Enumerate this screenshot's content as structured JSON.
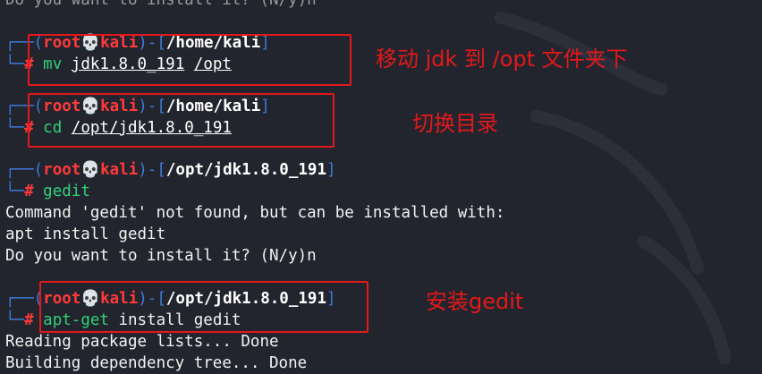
{
  "terminal": {
    "top_partial": "Do you want to install it? (N/y)n",
    "blocks": [
      {
        "user": "root",
        "skull": "💀",
        "host": "kali",
        "path": "/home/kali",
        "hash": "#",
        "command": "mv",
        "args": [
          "jdk1.8.0_191",
          "/opt"
        ]
      },
      {
        "user": "root",
        "skull": "💀",
        "host": "kali",
        "path": "/home/kali",
        "hash": "#",
        "command": "cd",
        "args": [
          "/opt/jdk1.8.0_191"
        ]
      },
      {
        "user": "root",
        "skull": "💀",
        "host": "kali",
        "path": "/opt/jdk1.8.0_191",
        "hash": "#",
        "command": "gedit",
        "output": [
          "Command 'gedit' not found, but can be installed with:",
          "apt install gedit",
          "Do you want to install it? (N/y)n"
        ]
      },
      {
        "user": "root",
        "skull": "💀",
        "host": "kali",
        "path": "/opt/jdk1.8.0_191",
        "hash": "#",
        "command": "apt-get",
        "rest": "install gedit",
        "output": [
          "Reading package lists... Done",
          "Building dependency tree... Done"
        ]
      }
    ]
  },
  "annotations": {
    "mv_note": "移动 jdk 到 /opt 文件夹下",
    "cd_note": "切换目录",
    "aptget_note": "安装gedit"
  },
  "colors": {
    "background": "#23252e",
    "prompt_bracket": "#3f79d9",
    "root_red": "#ff3a3a",
    "command_green": "#31d07a",
    "annotation_red": "#e3181a"
  }
}
